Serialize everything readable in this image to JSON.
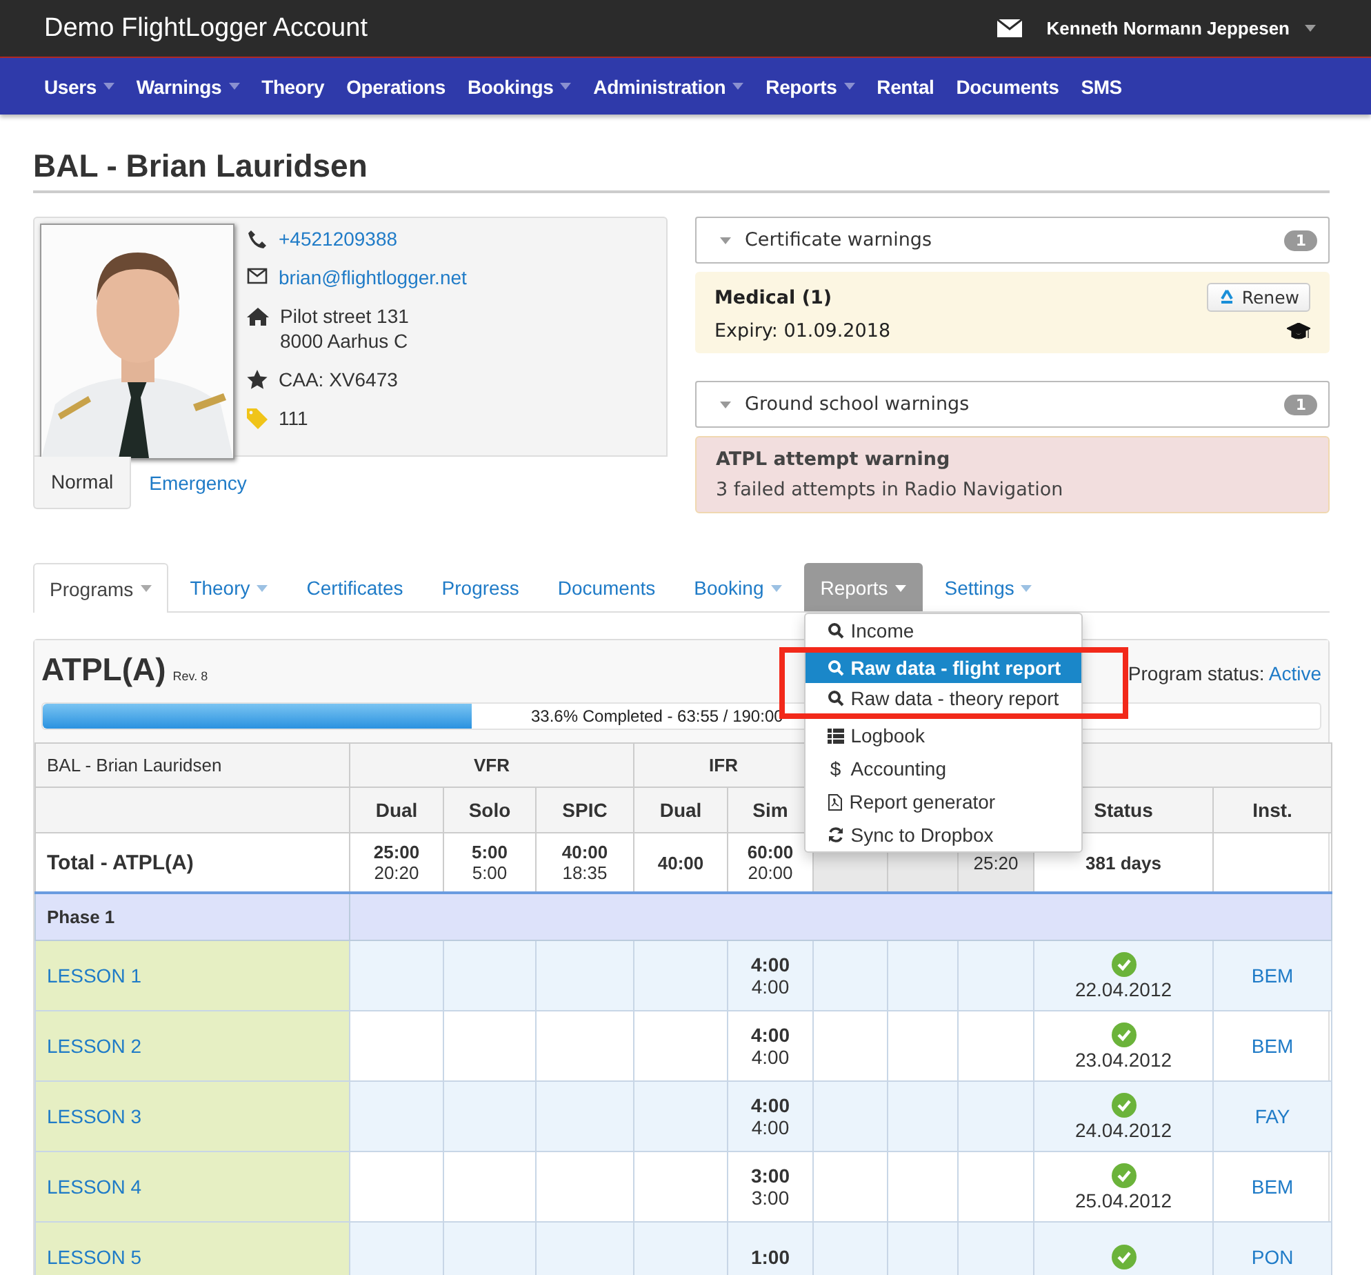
{
  "app": {
    "title": "Demo FlightLogger Account",
    "user": "Kenneth Normann Jeppesen"
  },
  "nav": [
    {
      "label": "Users",
      "dropdown": true
    },
    {
      "label": "Warnings",
      "dropdown": true
    },
    {
      "label": "Theory",
      "dropdown": false
    },
    {
      "label": "Operations",
      "dropdown": false
    },
    {
      "label": "Bookings",
      "dropdown": true
    },
    {
      "label": "Administration",
      "dropdown": true
    },
    {
      "label": "Reports",
      "dropdown": true
    },
    {
      "label": "Rental",
      "dropdown": false
    },
    {
      "label": "Documents",
      "dropdown": false
    },
    {
      "label": "SMS",
      "dropdown": false
    }
  ],
  "heading": "BAL - Brian Lauridsen",
  "profile": {
    "phone": "+4521209388",
    "email": "brian@flightlogger.net",
    "address": [
      "Pilot street 131",
      "8000 Aarhus C"
    ],
    "caa": "CAA: XV6473",
    "tag": "111",
    "tabs": [
      {
        "label": "Normal",
        "selected": true
      },
      {
        "label": "Emergency",
        "selected": false
      }
    ]
  },
  "warnings": [
    {
      "title": "Certificate warnings",
      "count": "1",
      "kind": "certificate",
      "heading": "Medical (1)",
      "text": "Expiry: 01.09.2018",
      "button": "Renew"
    },
    {
      "title": "Ground school warnings",
      "count": "1",
      "kind": "attempt",
      "heading": "ATPL attempt warning",
      "text": "3 failed attempts in Radio Navigation"
    }
  ],
  "program_tabs": [
    {
      "label": "Programs",
      "dropdown": true,
      "selected": false,
      "open": false
    },
    {
      "label": "Theory",
      "dropdown": true,
      "selected": false,
      "open": false
    },
    {
      "label": "Certificates",
      "dropdown": false,
      "selected": false,
      "open": false
    },
    {
      "label": "Progress",
      "dropdown": false,
      "selected": false,
      "open": false
    },
    {
      "label": "Documents",
      "dropdown": false,
      "selected": false,
      "open": false
    },
    {
      "label": "Booking",
      "dropdown": true,
      "selected": false,
      "open": false
    },
    {
      "label": "Reports",
      "dropdown": true,
      "selected": true,
      "open": true
    },
    {
      "label": "Settings",
      "dropdown": true,
      "selected": false,
      "open": false
    }
  ],
  "reports_menu": [
    {
      "label": "Income",
      "kind": "search",
      "selected": false,
      "highlighted": false
    },
    {
      "label": "Raw data - flight report",
      "kind": "search",
      "selected": true,
      "highlighted": true
    },
    {
      "label": "Raw data - theory report",
      "kind": "search",
      "selected": false,
      "highlighted": true
    },
    {
      "label": "Logbook",
      "kind": "list",
      "selected": false,
      "highlighted": false
    },
    {
      "label": "Accounting",
      "kind": "char",
      "symbol": "$",
      "selected": false,
      "highlighted": false
    },
    {
      "label": "Report generator",
      "kind": "pdf",
      "selected": false,
      "highlighted": false
    },
    {
      "label": "Sync to Dropbox",
      "kind": "sync",
      "selected": false,
      "highlighted": false
    }
  ],
  "program": {
    "title": "ATPL(A)",
    "revision": "Rev. 8",
    "level": 0.336,
    "progress_text": "33.6% Completed - 63:55 / 190:00",
    "status_label": "Program status:",
    "status": "Active"
  },
  "table": {
    "groups": [
      {
        "label": "BAL - Brian Lauridsen"
      },
      {
        "label": "VFR"
      },
      {
        "label": "IFR"
      }
    ],
    "columns": [
      null,
      "Dual",
      "Solo",
      "SPIC",
      "Dual",
      "Sim",
      null,
      null,
      null,
      "Status",
      "Inst."
    ],
    "total": {
      "name": "Total - ATPL(A)",
      "cells": [
        [
          "25:00",
          "20:20"
        ],
        [
          "5:00",
          "5:00"
        ],
        [
          "40:00",
          "18:35"
        ],
        [
          "40:00"
        ],
        [
          "60:00",
          "20:00"
        ],
        null,
        null,
        [
          "25:20"
        ],
        [
          "381 days"
        ],
        null
      ]
    },
    "phase": "Phase 1",
    "lessons": [
      {
        "name": "LESSON 1",
        "sim": [
          "4:00",
          "4:00"
        ],
        "completed": true,
        "date": "22.04.2012",
        "instructor": "BEM"
      },
      {
        "name": "LESSON 2",
        "sim": [
          "4:00",
          "4:00"
        ],
        "completed": true,
        "date": "23.04.2012",
        "instructor": "BEM"
      },
      {
        "name": "LESSON 3",
        "sim": [
          "4:00",
          "4:00"
        ],
        "completed": true,
        "date": "24.04.2012",
        "instructor": "FAY"
      },
      {
        "name": "LESSON 4",
        "sim": [
          "3:00",
          "3:00"
        ],
        "completed": true,
        "date": "25.04.2012",
        "instructor": "BEM"
      },
      {
        "name": "LESSON 5",
        "sim": [
          "1:00"
        ],
        "completed": true,
        "instructor": "PON"
      }
    ]
  }
}
